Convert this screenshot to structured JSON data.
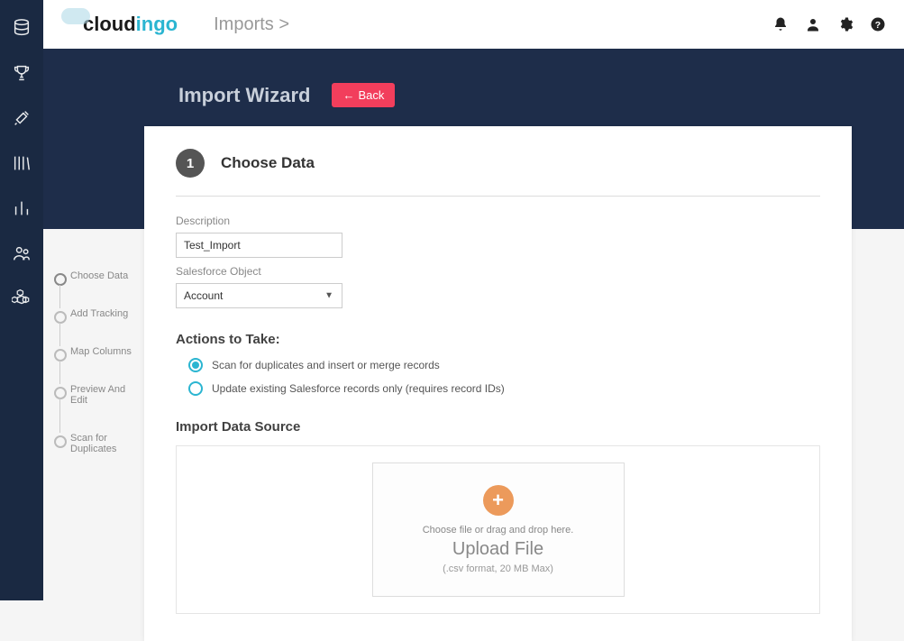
{
  "logo": {
    "part1": "cloud",
    "part2": "ingo"
  },
  "breadcrumb": "Imports  >",
  "hero": {
    "title": "Import Wizard",
    "back": "Back"
  },
  "step": {
    "num": "1",
    "title": "Choose Data"
  },
  "fields": {
    "desc_label": "Description",
    "desc_value": "Test_Import",
    "sf_label": "Salesforce Object",
    "sf_value": "Account"
  },
  "actions": {
    "title": "Actions to Take:",
    "option1": "Scan for duplicates and insert or merge records",
    "option2": "Update existing Salesforce records only (requires record IDs)"
  },
  "import_source": {
    "title": "Import Data Source",
    "hint": "Choose file or drag and drop here.",
    "text": "Upload File",
    "sub": "(.csv format, 20 MB Max)"
  },
  "stepper": [
    "Choose Data",
    "Add Tracking",
    "Map Columns",
    "Preview And Edit",
    "Scan for Duplicates"
  ],
  "colors": {
    "accent": "#2bb5d1",
    "danger": "#f23e5c",
    "dark": "#1e2d4a"
  }
}
